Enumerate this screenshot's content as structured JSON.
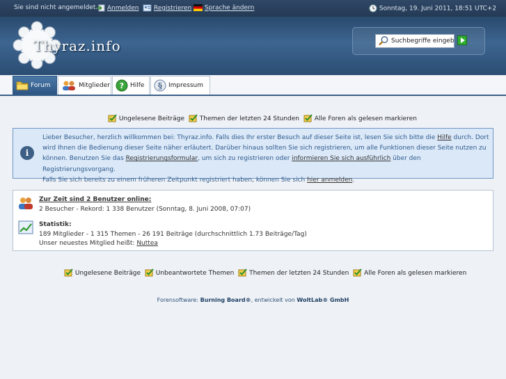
{
  "topbar": {
    "status": "Sie sind nicht angemeldet.",
    "login": "Anmelden",
    "register": "Registrieren",
    "language": "Sprache ändern",
    "datetime": "Sonntag, 19. Juni 2011, 18:51 UTC+2"
  },
  "header": {
    "logo_text": "Thyraz.info",
    "search_placeholder": "Suchbegriffe eingeben"
  },
  "tabs": [
    {
      "label": "Forum",
      "icon": "folder-icon"
    },
    {
      "label": "Mitglieder",
      "icon": "members-icon"
    },
    {
      "label": "Hilfe",
      "icon": "help-icon"
    },
    {
      "label": "Impressum",
      "icon": "paragraph-icon"
    }
  ],
  "quicklinks_top": {
    "unread": "Ungelesene Beiträge",
    "last24": "Themen der letzten 24 Stunden",
    "markall": "Alle Foren als gelesen markieren"
  },
  "info": {
    "l1a": "Lieber Besucher, herzlich willkommen bei: Thyraz.info. Falls dies Ihr erster Besuch auf dieser Seite ist, lesen Sie sich bitte die ",
    "l1link": "Hilfe",
    "l1b": " durch. Dort",
    "l2": "wird Ihnen die Bedienung dieser Seite näher erläutert. Darüber hinaus sollten Sie sich registrieren, um alle Funktionen dieser Seite nutzen zu",
    "l3a": "können. Benutzen Sie das ",
    "l3link1": "Registrierungsformular",
    "l3b": ", um sich zu registrieren oder ",
    "l3link2": "informieren Sie sich ausführlich",
    "l3c": " über den Registrierungsvorgang.",
    "l4a": "Falls Sie sich bereits zu einem früheren Zeitpunkt registriert haben, können Sie sich ",
    "l4link": "hier anmelden",
    "l4b": "."
  },
  "stats": {
    "online_heading": "Zur Zeit sind 2 Benutzer online:",
    "online_detail": "2 Besucher - Rekord: 1 338 Benutzer (Sonntag, 8. Juni 2008, 07:07)",
    "stat_heading": "Statistik:",
    "stat_detail": "189 Mitglieder - 1 315 Themen - 26 191 Beiträge (durchschnittlich 1.73 Beiträge/Tag)",
    "newest_label": "Unser neuestes Mitglied heißt: ",
    "newest_name": "Nuttea"
  },
  "quicklinks_bottom": {
    "unread": "Ungelesene Beiträge",
    "unanswered": "Unbeantwortete Themen",
    "last24": "Themen der letzten 24 Stunden",
    "markall": "Alle Foren als gelesen markieren"
  },
  "footer": {
    "prefix": "Forensoftware: ",
    "product": "Burning Board®",
    "middle": ", entwickelt von ",
    "company": "WoltLab® GmbH"
  }
}
